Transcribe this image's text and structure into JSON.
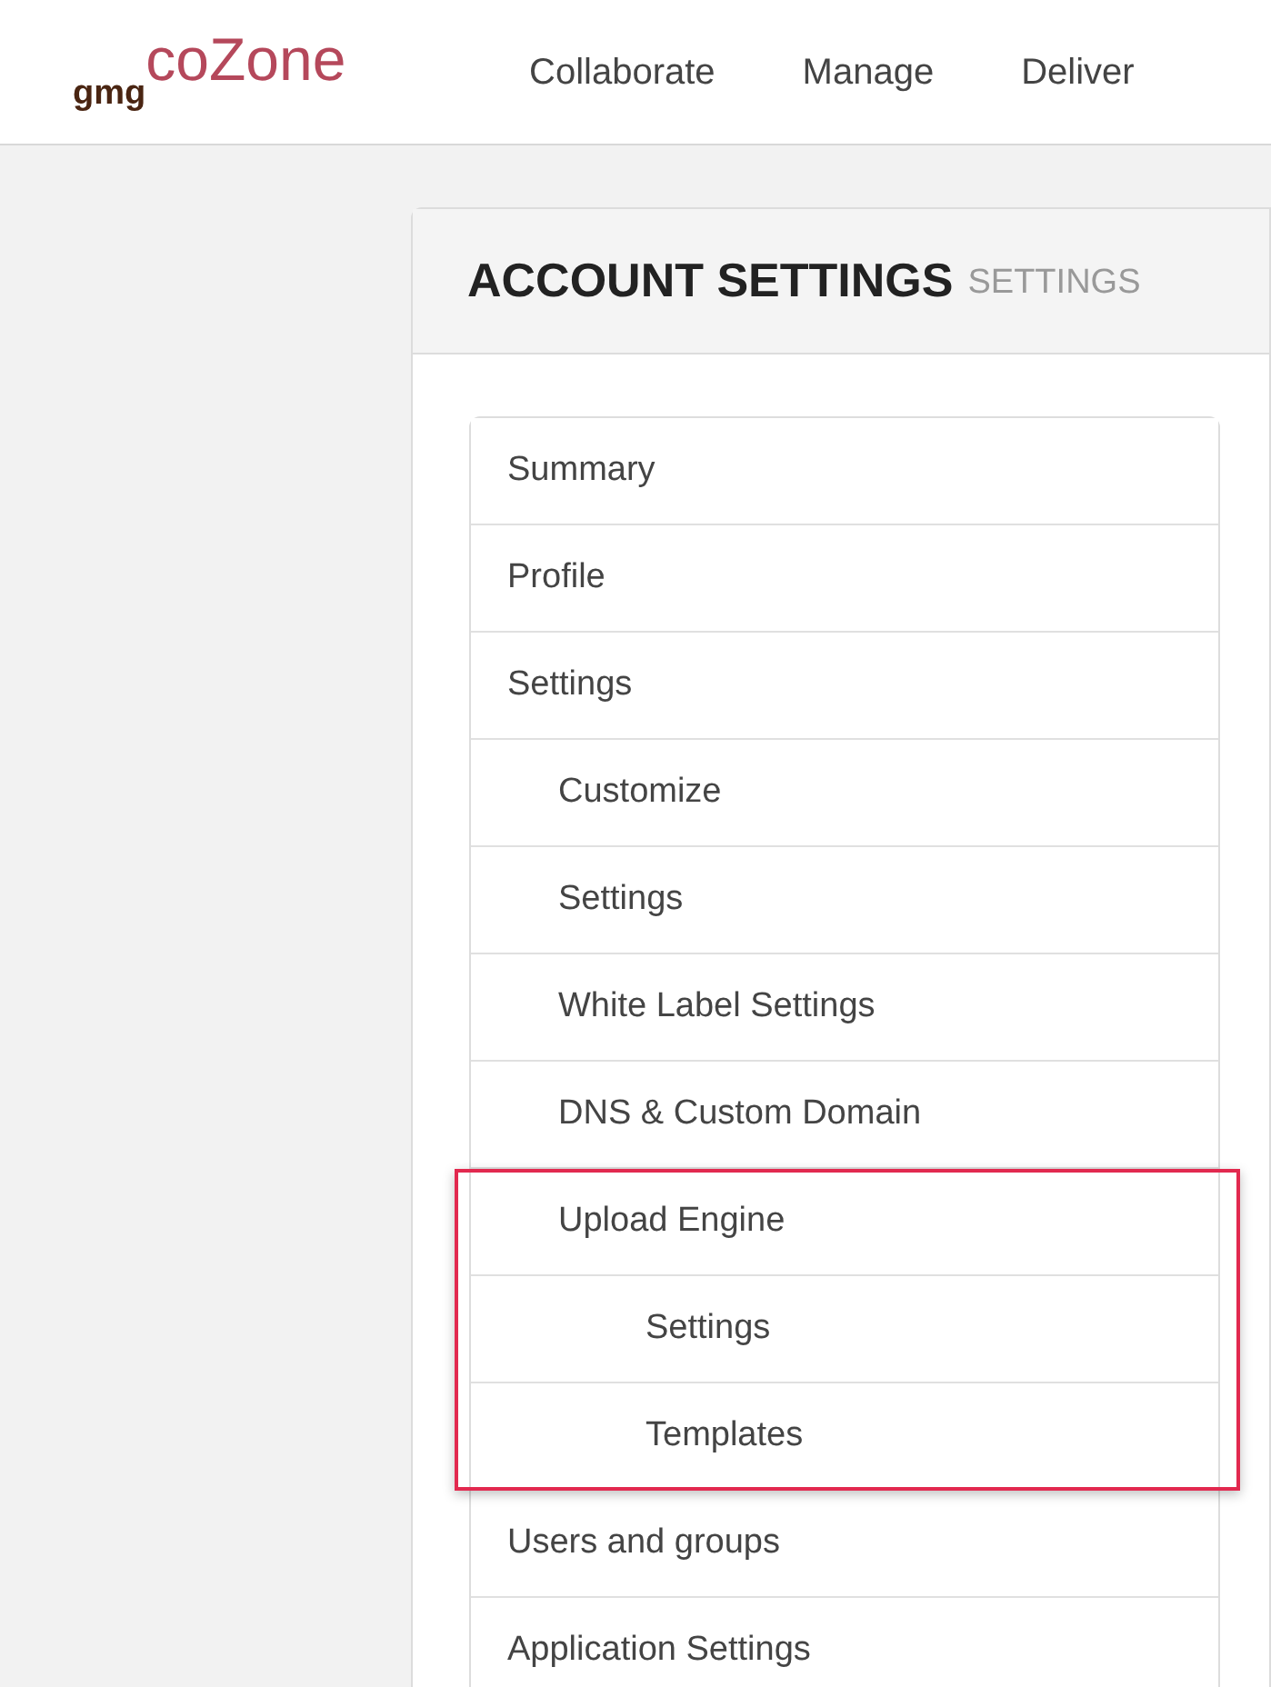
{
  "logo": {
    "prefix": "gmg",
    "name": "coZone"
  },
  "nav": [
    {
      "label": "Collaborate"
    },
    {
      "label": "Manage"
    },
    {
      "label": "Deliver"
    }
  ],
  "page": {
    "title": "ACCOUNT SETTINGS",
    "subtitle": "SETTINGS"
  },
  "menu": [
    {
      "label": "Summary"
    },
    {
      "label": "Profile"
    },
    {
      "label": "Settings",
      "children": [
        {
          "label": "Customize"
        },
        {
          "label": "Settings"
        },
        {
          "label": "White Label Settings"
        },
        {
          "label": "DNS & Custom Domain"
        },
        {
          "label": "Upload Engine",
          "highlighted": true,
          "children": [
            {
              "label": "Settings"
            },
            {
              "label": "Templates"
            }
          ]
        }
      ]
    },
    {
      "label": "Users and groups"
    },
    {
      "label": "Application Settings"
    }
  ]
}
